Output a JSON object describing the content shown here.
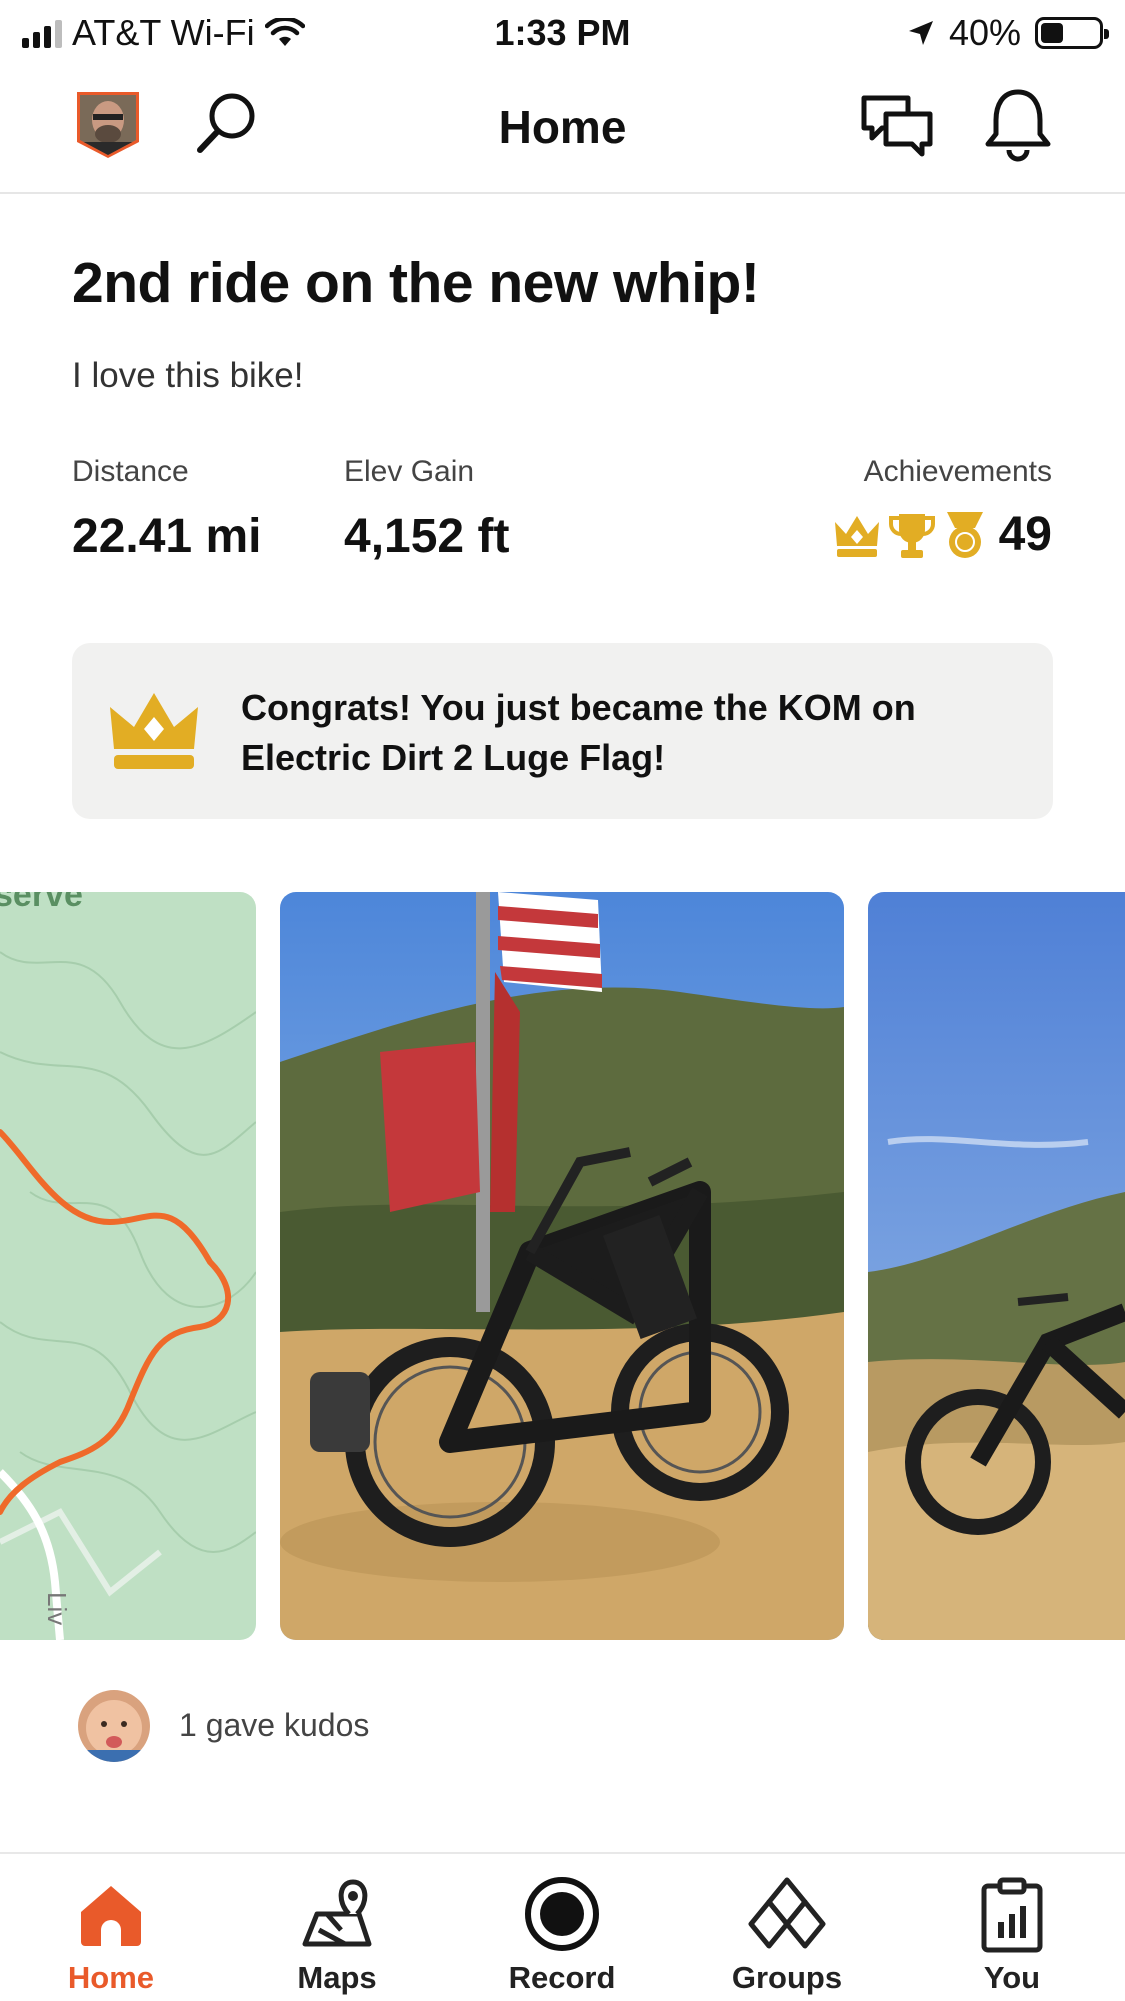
{
  "status_bar": {
    "carrier": "AT&T Wi-Fi",
    "time": "1:33 PM",
    "battery": "40%",
    "battery_level": 0.4
  },
  "nav": {
    "title": "Home",
    "icons": [
      "avatar",
      "search-icon",
      "chat-icon",
      "bell-icon"
    ]
  },
  "post": {
    "title": "2nd ride on the new whip!",
    "description": "I love this bike!",
    "stats": [
      {
        "label": "Distance",
        "value": "22.41 mi"
      },
      {
        "label": "Elev Gain",
        "value": "4,152 ft"
      }
    ],
    "achievements": {
      "label": "Achievements",
      "count": "49",
      "icons": [
        "crown-icon",
        "trophy-icon",
        "medal-icon"
      ]
    },
    "kom_message": "Congrats! You just became the KOM on Electric Dirt 2 Luge Flag!",
    "map_labels": {
      "top": "serve",
      "road": "Liv"
    },
    "kudos": "1 gave kudos"
  },
  "tabs": [
    {
      "label": "Home",
      "icon": "home-icon",
      "active": true
    },
    {
      "label": "Maps",
      "icon": "maps-icon",
      "active": false
    },
    {
      "label": "Record",
      "icon": "record-icon",
      "active": false
    },
    {
      "label": "Groups",
      "icon": "groups-icon",
      "active": false
    },
    {
      "label": "You",
      "icon": "you-icon",
      "active": false
    }
  ],
  "colors": {
    "accent": "#e95a2a",
    "gold": "#e2ad24",
    "card_bg": "#f1f1f0",
    "map_green": "#bfe0c4",
    "route": "#ef6a2a"
  }
}
